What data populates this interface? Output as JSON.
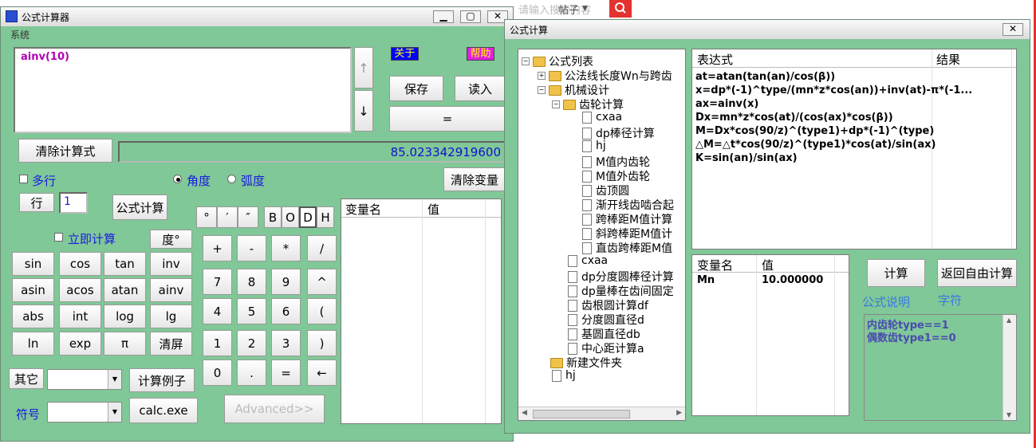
{
  "background_page": {
    "search_hint": "请输入搜索内容",
    "scope": "帖子",
    "chevron": "chevron-down-icon",
    "search_icon": "search-icon"
  },
  "calc_window": {
    "title": "公式计算器",
    "menu": [
      "系统"
    ],
    "expression": "ainv(10)",
    "about_label": "关于",
    "help_label": "帮助",
    "save_label": "保存",
    "load_label": "读入",
    "equals_label": "=",
    "clear_formula_label": "清除计算式",
    "result": "85.023342919600",
    "multi_row_label": "多行",
    "angle_label": "角度",
    "radian_label": "弧度",
    "clear_vars_label": "清除变量",
    "row_label": "行",
    "row_value": "1",
    "formula_calc_label": "公式计算",
    "instant_calc_label": "立即计算",
    "degree_label": "度°",
    "dms_keys": [
      "°",
      "′",
      "″"
    ],
    "base_keys": [
      "B",
      "O",
      "D",
      "H"
    ],
    "func_keys": [
      [
        "sin",
        "cos",
        "tan",
        "inv"
      ],
      [
        "asin",
        "acos",
        "atan",
        "ainv"
      ],
      [
        "abs",
        "int",
        "log",
        "lg"
      ],
      [
        "ln",
        "exp",
        "π",
        "清屏"
      ]
    ],
    "num_keys": [
      [
        "+",
        "-",
        "*",
        "/"
      ],
      [
        "7",
        "8",
        "9",
        "^"
      ],
      [
        "4",
        "5",
        "6",
        "("
      ],
      [
        "1",
        "2",
        "3",
        ")"
      ],
      [
        "0",
        ".",
        "=",
        "←"
      ]
    ],
    "other_label": "其它",
    "example_label": "计算例子",
    "symbol_label": "符号",
    "calcexe_label": "calc.exe",
    "advanced_label": "Advanced>>",
    "var_table_headers": [
      "变量名",
      "值"
    ]
  },
  "formula_window": {
    "title": "公式计算",
    "tree": [
      {
        "label": "公式列表",
        "type": "folder",
        "expander": "⊟"
      },
      {
        "label": "公法线长度Wn与跨齿",
        "type": "folder",
        "expander": "⊞"
      },
      {
        "label": "机械设计",
        "type": "folder",
        "expander": "⊟"
      },
      {
        "label": "齿轮计算",
        "type": "folder",
        "expander": "⊟"
      },
      {
        "label": "cxaa",
        "type": "doc"
      },
      {
        "label": "dp棒径计算",
        "type": "doc"
      },
      {
        "label": "hj",
        "type": "doc"
      },
      {
        "label": "M值内齿轮",
        "type": "doc"
      },
      {
        "label": "M值外齿轮",
        "type": "doc"
      },
      {
        "label": "齿顶圆",
        "type": "doc"
      },
      {
        "label": "渐开线齿啮合起",
        "type": "doc"
      },
      {
        "label": "跨棒距M值计算",
        "type": "doc"
      },
      {
        "label": "斜跨棒距M值计",
        "type": "doc"
      },
      {
        "label": "直齿跨棒距M值",
        "type": "doc"
      },
      {
        "label": "cxaa",
        "type": "doc"
      },
      {
        "label": "dp分度圆棒径计算",
        "type": "doc"
      },
      {
        "label": "dp量棒在齿间固定",
        "type": "doc"
      },
      {
        "label": "齿根圆计算df",
        "type": "doc"
      },
      {
        "label": "分度圆直径d",
        "type": "doc"
      },
      {
        "label": "基圆直径db",
        "type": "doc"
      },
      {
        "label": "中心距计算a",
        "type": "doc"
      },
      {
        "label": "新建文件夹",
        "type": "folder"
      },
      {
        "label": "hj",
        "type": "doc"
      }
    ],
    "expr_headers": [
      "表达式",
      "结果"
    ],
    "expressions": [
      "at=atan(tan(an)/cos(β))",
      "x=dp*(-1)^type/(mn*z*cos(an))+inv(at)-π*(-1...",
      "ax=ainv(x)",
      "Dx=mn*z*cos(at)/(cos(ax)*cos(β))",
      "M=Dx*cos(90/z)^(type1)+dp*(-1)^(type)",
      "△M=△t*cos(90/z)^(type1)*cos(at)/sin(ax)",
      "K=sin(an)/sin(ax)"
    ],
    "var_headers": [
      "变量名",
      "值"
    ],
    "vars": [
      {
        "name": "Mn",
        "value": "10.000000"
      }
    ],
    "calc_label": "计算",
    "back_label": "返回自由计算",
    "desc_label": "公式说明",
    "char_label": "字符",
    "notes": [
      "内齿轮type==1",
      "偶数齿type1==0"
    ]
  }
}
